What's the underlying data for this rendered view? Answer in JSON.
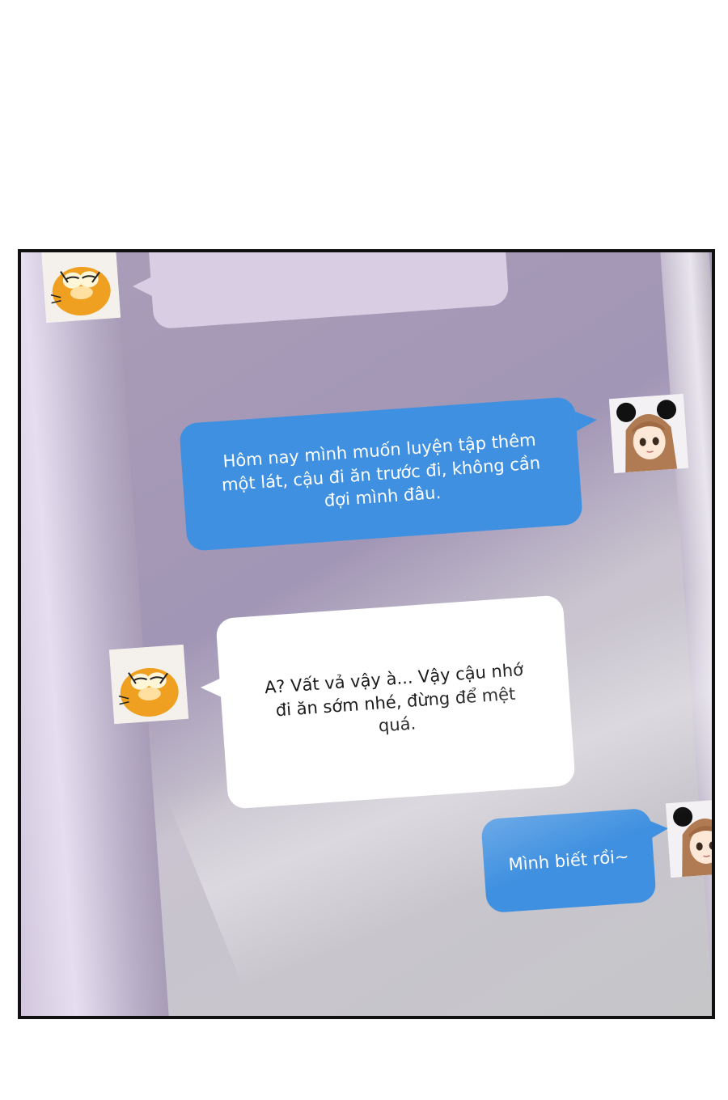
{
  "chat": {
    "messages": [
      {
        "sender": "garfield",
        "side": "left",
        "text": ""
      },
      {
        "sender": "girl",
        "side": "right",
        "text": "Hôm nay mình muốn luyện tập thêm một lát, cậu đi ăn trước đi, không cần đợi mình đâu."
      },
      {
        "sender": "garfield",
        "side": "left",
        "text": "A? Vất vả vậy à... Vậy cậu nhớ đi ăn sớm nhé, đừng để mệt quá."
      },
      {
        "sender": "girl",
        "side": "right",
        "text": "Mình biết rồi~"
      }
    ]
  },
  "avatars": {
    "garfield": {
      "icon": "garfield-cat-avatar-icon",
      "color": "#f0a020"
    },
    "girl": {
      "icon": "girl-mouse-ears-avatar-icon",
      "color": "#8a5a3c"
    }
  },
  "colors": {
    "outgoing_bubble": "#3f90e0",
    "incoming_bubble": "#ffffff",
    "panel_border": "#111111"
  }
}
